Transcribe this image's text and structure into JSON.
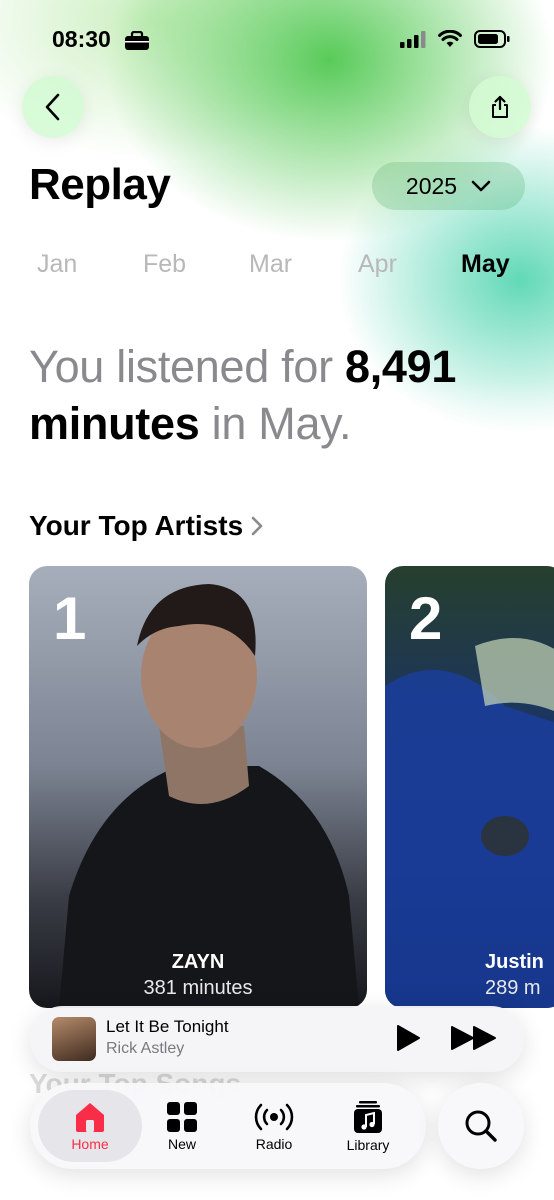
{
  "status_bar": {
    "time": "08:30"
  },
  "header": {
    "title": "Replay",
    "year": "2025"
  },
  "months": [
    "Jan",
    "Feb",
    "Mar",
    "Apr",
    "May"
  ],
  "selected_month": "May",
  "summary": {
    "prefix": "You listened for ",
    "minutes": "8,491",
    "unit": "minutes",
    "suffix": " in May."
  },
  "top_artists": {
    "title": "Your Top Artists",
    "items": [
      {
        "rank": "1",
        "name": "ZAYN",
        "minutes": "381 minutes"
      },
      {
        "rank": "2",
        "name": "Justin",
        "minutes": "289 m"
      }
    ]
  },
  "top_songs_title": "Your Top Songs",
  "now_playing": {
    "title": "Let It Be Tonight",
    "artist": "Rick Astley"
  },
  "tabs": [
    {
      "label": "Home"
    },
    {
      "label": "New"
    },
    {
      "label": "Radio"
    },
    {
      "label": "Library"
    }
  ],
  "colors": {
    "accent": "#fa2d48",
    "glow_green": "#50c850",
    "glow_teal": "#46d2aa"
  }
}
